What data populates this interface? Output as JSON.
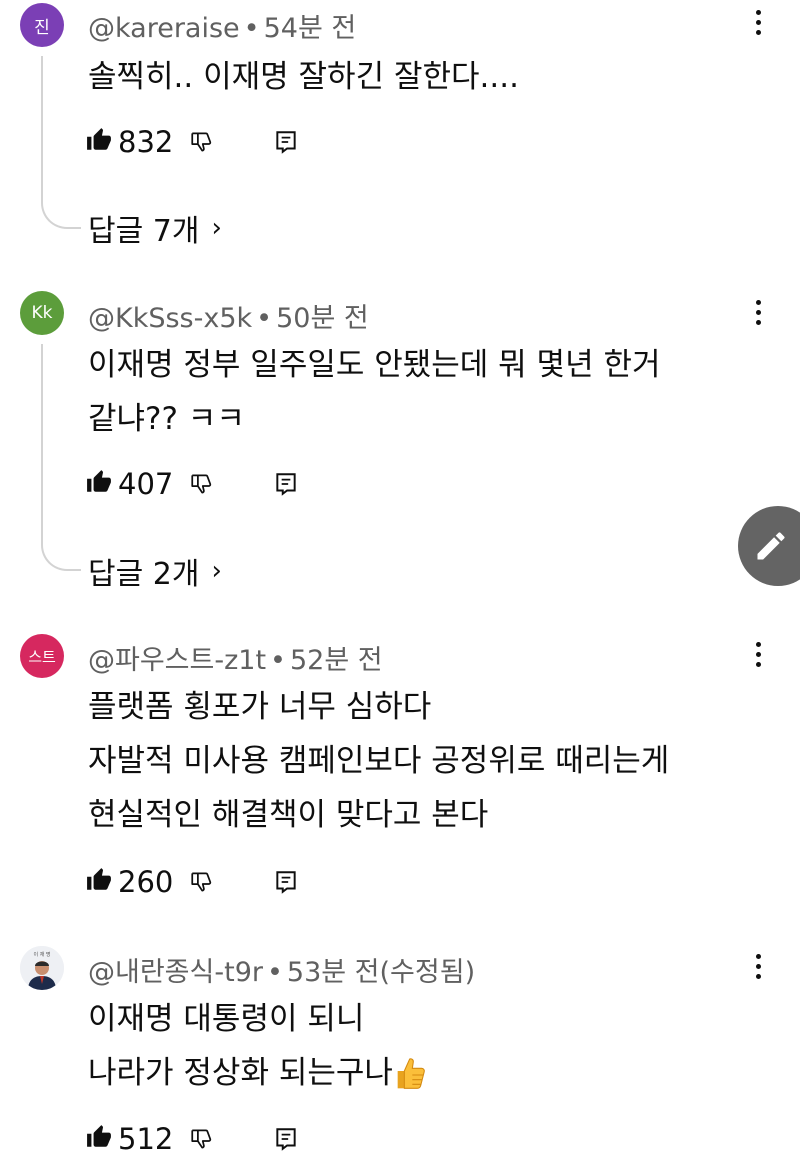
{
  "comments": [
    {
      "avatar_text": "진",
      "avatar_color": "#7b3fb5",
      "author": "@kareraise",
      "time": "54분 전",
      "lines": [
        "솔찍히.. 이재명 잘하긴 잘한다...."
      ],
      "likes": "832",
      "replies_label": "답글 7개"
    },
    {
      "avatar_text": "Kk",
      "avatar_color": "#5c9d3b",
      "author": "@KkSss-x5k",
      "time": "50분 전",
      "lines": [
        "이재명 정부 일주일도 안됐는데 뭐 몇년 한거",
        "같냐?? ㅋㅋ"
      ],
      "likes": "407",
      "replies_label": "답글 2개"
    },
    {
      "avatar_text": "스트",
      "avatar_color": "#d6285f",
      "author": "@파우스트-z1t",
      "time": "52분 전",
      "lines": [
        "플랫폼 횡포가 너무 심하다",
        "자발적 미사용 캠페인보다 공정위로 때리는게",
        "현실적인 해결책이 맞다고 본다"
      ],
      "likes": "260"
    },
    {
      "avatar_text": "",
      "avatar_color": "#eef0f4",
      "author": "@내란종식-t9r",
      "time": "53분 전(수정됨)",
      "lines": [
        "이재명 대통령이 되니",
        "나라가 정상화 되는구나"
      ],
      "likes": "512"
    }
  ],
  "icons": {
    "like": "thumbs-up-icon",
    "dislike": "thumbs-down-icon",
    "reply": "reply-icon",
    "more": "more-vert-icon",
    "edit": "pencil-icon",
    "emoji": "thumbs-up-emoji"
  },
  "separator": "•"
}
